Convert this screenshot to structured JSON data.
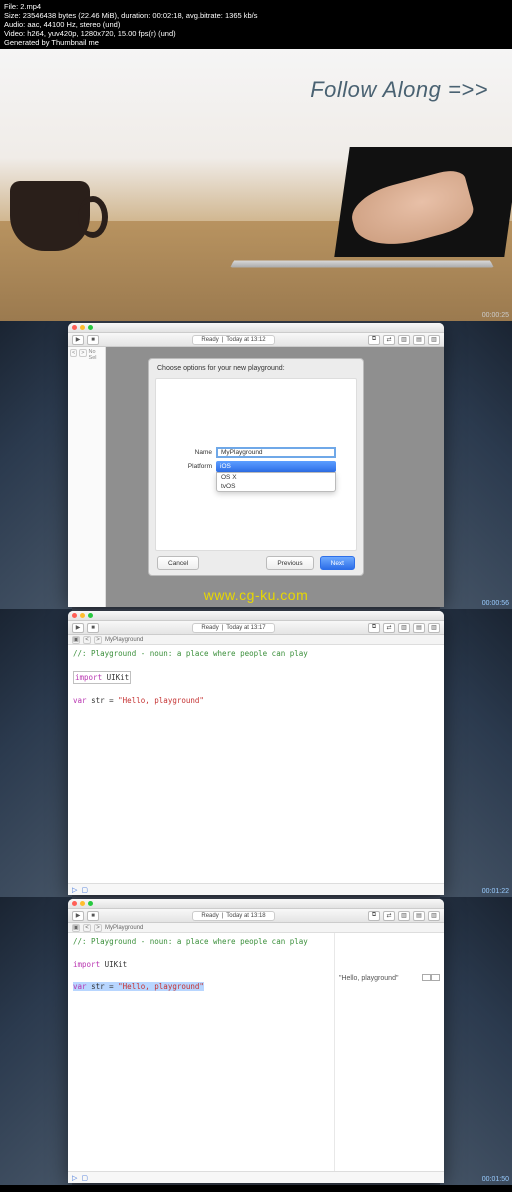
{
  "meta": {
    "file": "File: 2.mp4",
    "size": "Size: 23546438 bytes (22.46 MiB), duration: 00:02:18, avg.bitrate: 1365 kb/s",
    "audio": "Audio: aac, 44100 Hz, stereo (und)",
    "video": "Video: h264, yuv420p, 1280x720, 15.00 fps(r) (und)",
    "gen": "Generated by Thumbnail me"
  },
  "sec1": {
    "title": "Follow Along =>>",
    "ts": "00:00:25"
  },
  "toolbar": {
    "run_icon": "▶",
    "stop_icon": "■",
    "status_ready": "Ready",
    "pipe": "|",
    "icon_split": "⧉",
    "icon_assist": "⇄",
    "icon_panel_l": "▥",
    "icon_panel_b": "▤",
    "icon_panel_r": "▥"
  },
  "sec2": {
    "status_time": "Today at 13:12",
    "sidebar": {
      "no_sel": "No Sel"
    },
    "dialog": {
      "title": "Choose options for your new playground:",
      "name_label": "Name",
      "name_value": "MyPlayground",
      "platform_label": "Platform",
      "platform_selected": "iOS",
      "platform_options": [
        "OS X",
        "tvOS"
      ],
      "cancel": "Cancel",
      "previous": "Previous",
      "next": "Next"
    },
    "watermark": "www.cg-ku.com",
    "ts": "00:00:56"
  },
  "sec3": {
    "status_time": "Today at 13:17",
    "breadcrumb": "MyPlayground",
    "code": {
      "comment": "//: Playground - noun: a place where people can play",
      "import_kw": "import",
      "import_mod": "UIKit",
      "var_kw": "var",
      "var_name": "str =",
      "string": "\"Hello, playground\""
    },
    "ts": "00:01:22"
  },
  "sec4": {
    "status_time": "Today at 13:18",
    "breadcrumb": "MyPlayground",
    "code": {
      "comment": "//: Playground - noun: a place where people can play",
      "import_kw": "import",
      "import_mod": "UIKit",
      "var_kw": "var",
      "var_name": "str =",
      "string": "\"Hello, playground\""
    },
    "result": "\"Hello, playground\"",
    "ts": "00:01:50"
  },
  "glyphs": {
    "lt": "<",
    "gt": ">",
    "square": "▣",
    "play": "▷",
    "sq2": "▢"
  }
}
